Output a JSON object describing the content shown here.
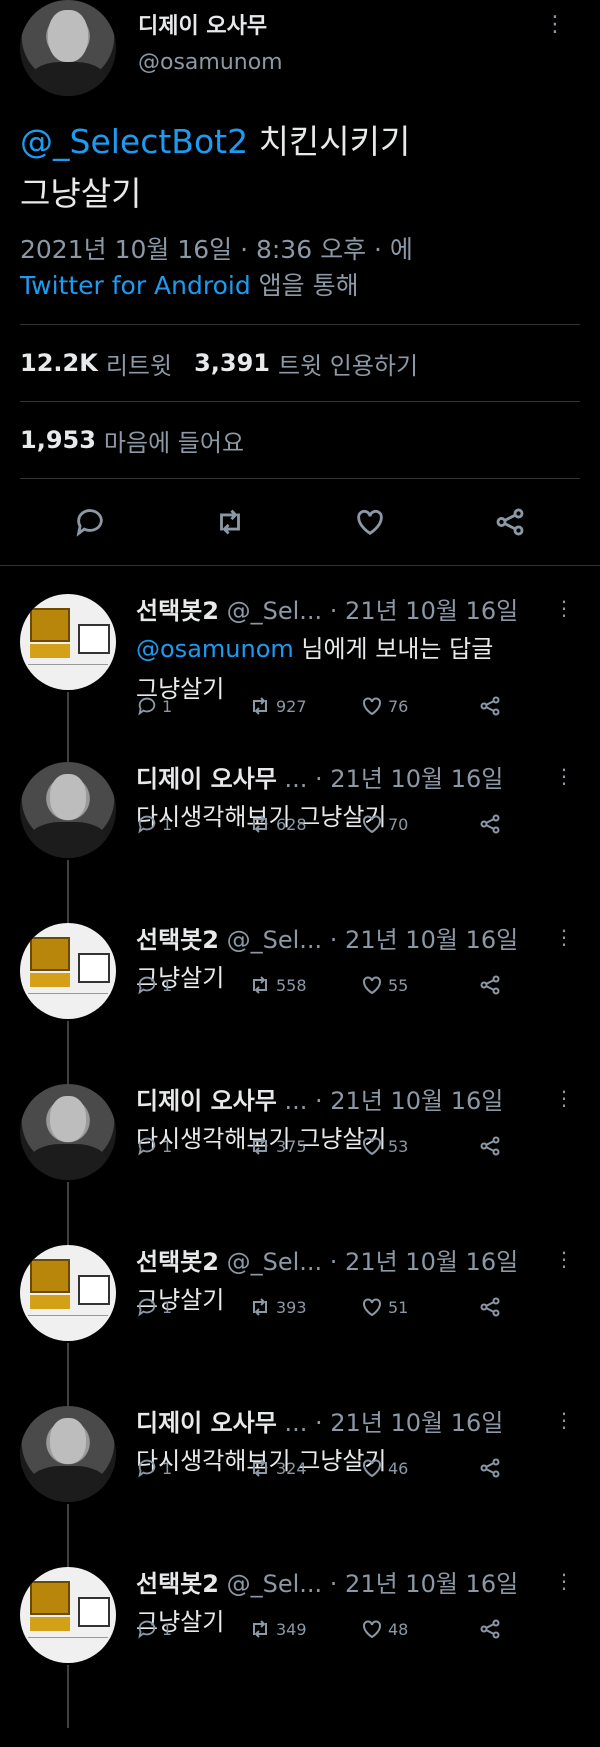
{
  "author": {
    "name": "디제이 오사무",
    "handle": "@osamunom"
  },
  "tweet": {
    "mention": "@_SelectBot2",
    "text_after_mention": " 치킨시키기",
    "text_line2": "그냥살기",
    "timestamp": "2021년 10월 16일 · 8:36 오후 · 에",
    "via_client": "Twitter for Android",
    "via_suffix": " 앱을 통해"
  },
  "stats": {
    "retweets_value": "12.2K",
    "retweets_label": "리트윗",
    "quotes_value": "3,391",
    "quotes_label": "트윗 인용하기",
    "likes_value": "1,953",
    "likes_label": "마음에 들어요"
  },
  "replies": [
    {
      "avatar": "bot",
      "name": "선택봇2",
      "handle": "@_Sel...",
      "date": "· 21년 10월 16일",
      "reply_to_mention": "@osamunom",
      "reply_to_suffix": " 님에게 보내는 답글",
      "text": "그냥살기",
      "replies": "1",
      "retweets": "927",
      "likes": "76"
    },
    {
      "avatar": "person",
      "name": "디제이 오사무",
      "handle": "...",
      "date": "· 21년 10월 16일",
      "text": "다시생각해보기 그냥살기",
      "replies": "1",
      "retweets": "628",
      "likes": "70"
    },
    {
      "avatar": "bot",
      "name": "선택봇2",
      "handle": "@_Sel...",
      "date": "· 21년 10월 16일",
      "text": "그냥살기",
      "replies": "1",
      "retweets": "558",
      "likes": "55"
    },
    {
      "avatar": "person",
      "name": "디제이 오사무",
      "handle": "...",
      "date": "· 21년 10월 16일",
      "text": "다시생각해보기 그냥살기",
      "replies": "1",
      "retweets": "375",
      "likes": "53"
    },
    {
      "avatar": "bot",
      "name": "선택봇2",
      "handle": "@_Sel...",
      "date": "· 21년 10월 16일",
      "text": "그냥살기",
      "replies": "1",
      "retweets": "393",
      "likes": "51"
    },
    {
      "avatar": "person",
      "name": "디제이 오사무",
      "handle": "...",
      "date": "· 21년 10월 16일",
      "text": "다시생각해보기 그냥살기",
      "replies": "1",
      "retweets": "324",
      "likes": "46"
    },
    {
      "avatar": "bot",
      "name": "선택봇2",
      "handle": "@_Sel...",
      "date": "· 21년 10월 16일",
      "text": "그냥살기",
      "replies": "1",
      "retweets": "349",
      "likes": "48"
    }
  ],
  "icons": {
    "reply": "reply-icon",
    "retweet": "retweet-icon",
    "like": "heart-icon",
    "share": "share-icon",
    "more": "more-icon"
  },
  "colors": {
    "background": "#000000",
    "text": "#e7e9ea",
    "muted": "#8b98a5",
    "accent": "#1d9bf0",
    "divider": "#2f3336"
  }
}
